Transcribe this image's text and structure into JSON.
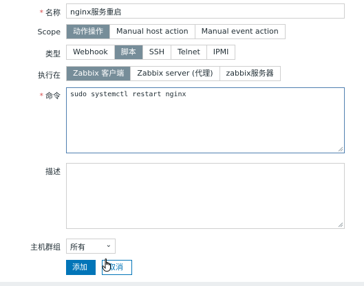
{
  "form": {
    "name": {
      "label": "名称",
      "value": "nginx服务重启"
    },
    "scope": {
      "label": "Scope",
      "options": [
        "动作操作",
        "Manual host action",
        "Manual event action"
      ],
      "selected": "动作操作"
    },
    "type": {
      "label": "类型",
      "options": [
        "Webhook",
        "脚本",
        "SSH",
        "Telnet",
        "IPMI"
      ],
      "selected": "脚本"
    },
    "execute_on": {
      "label": "执行在",
      "options": [
        "Zabbix 客户端",
        "Zabbix server (代理)",
        "zabbix服务器"
      ],
      "selected": "Zabbix 客户端"
    },
    "command": {
      "label": "命令",
      "value": "sudo systemctl restart nginx"
    },
    "description": {
      "label": "描述",
      "value": ""
    },
    "host_group": {
      "label": "主机群组",
      "value": "所有"
    },
    "buttons": {
      "add": "添加",
      "cancel": "取消"
    },
    "required_mark": "*"
  },
  "colors": {
    "active_segment": "#768d99",
    "primary": "#0275b8",
    "required": "#d64e4e",
    "border": "#cfcfcf"
  },
  "icons": {
    "select_chevron": "chevron-down-icon",
    "pointer": "hand-pointer-icon",
    "resize": "resize-grip-icon"
  }
}
